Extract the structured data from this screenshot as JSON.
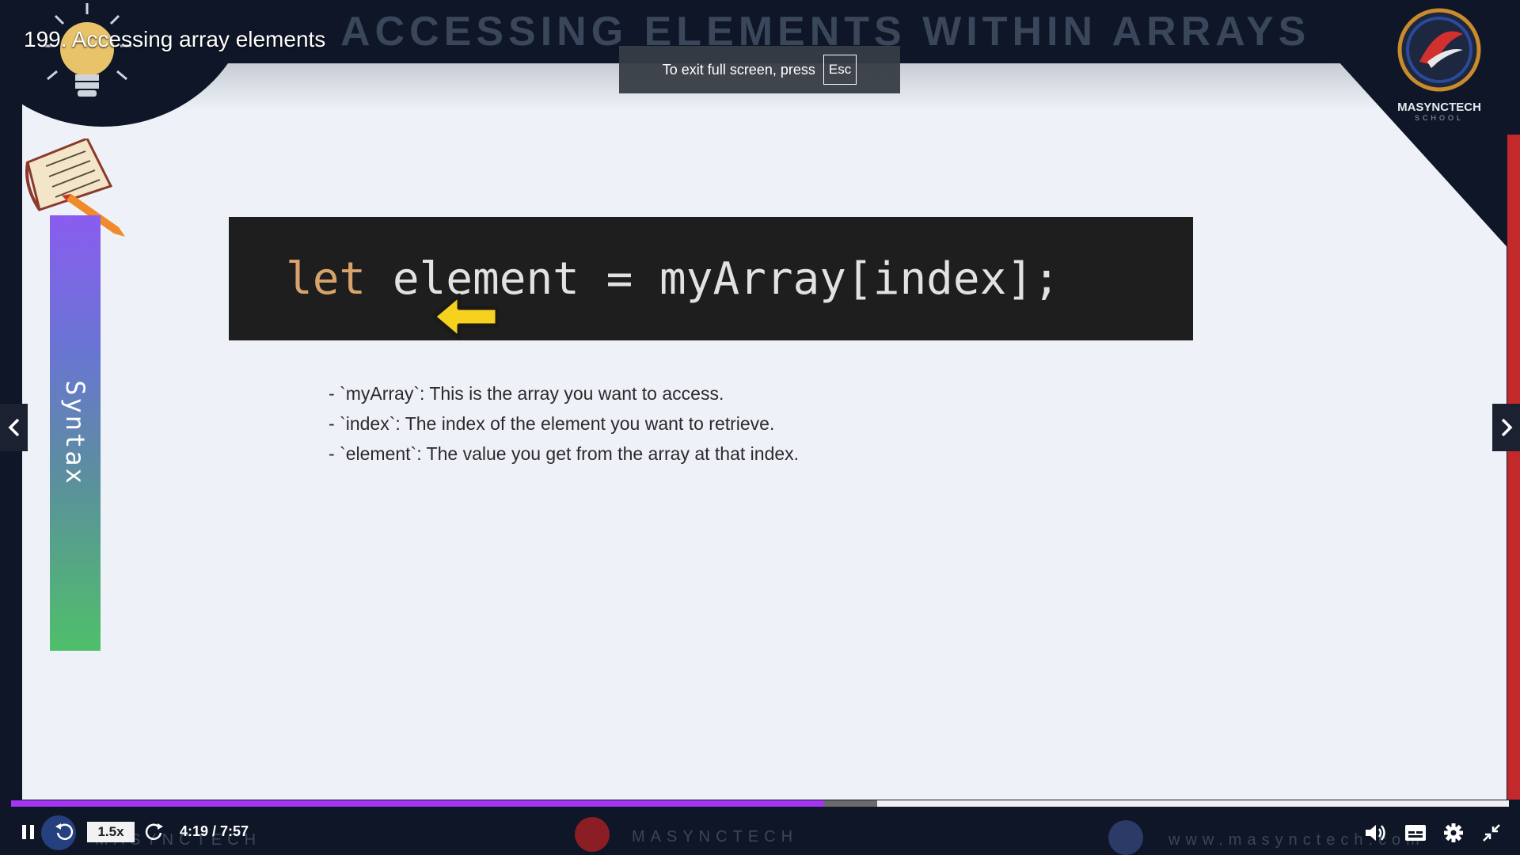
{
  "video": {
    "title": "199. Accessing array elements",
    "current_time": "4:19",
    "separator": "/",
    "duration": "7:57",
    "time_display": "4:19 / 7:57",
    "speed": "1.5x",
    "progress": 0.543,
    "buffered": 0.578
  },
  "toast": {
    "text": "To exit full screen, press",
    "key": "Esc"
  },
  "slide": {
    "heading": "ACCESSING ELEMENTS WITHIN ARRAYS",
    "side_label": "Syntax",
    "code_keyword": "let",
    "code_rest": " element = myArray[index];",
    "bullets": [
      "- `myArray`: This is the array you want to access.",
      "- `index`: The index of the element you want to retrieve.",
      "- `element`: The value you get from the array at that index."
    ],
    "logo_name": "MASYNCTECH",
    "logo_sub": "SCHOOL",
    "watermark_center": "MASYNCTECH",
    "watermark_left": "MASYNCTECH",
    "watermark_right": "www.masynctech.com"
  },
  "colors": {
    "progress": "#a435f0",
    "code_bg": "#1e1e1e",
    "keyword": "#d7a36a",
    "accent_red": "#c3282a"
  },
  "icons": {
    "prev": "chevron-left-icon",
    "next": "chevron-right-icon",
    "pause": "pause-icon",
    "rewind": "rewind-icon",
    "forward": "forward-icon",
    "volume": "volume-icon",
    "captions": "captions-icon",
    "settings": "gear-icon",
    "exit_fullscreen": "exit-fullscreen-icon"
  }
}
